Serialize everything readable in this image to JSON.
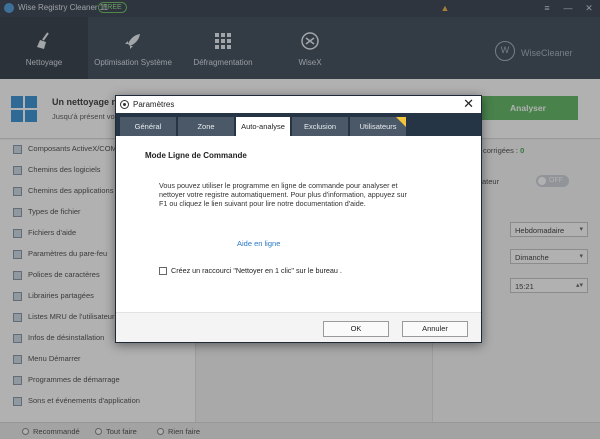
{
  "app": {
    "title": "Wise Registry Cleaner 11",
    "edition_badge": "FREE",
    "window_controls": [
      "≡",
      "—",
      "✕"
    ]
  },
  "toolbar": {
    "items": [
      {
        "label": "Nettoyage",
        "icon": "broom-icon"
      },
      {
        "label": "Optimisation Système",
        "icon": "rocket-icon"
      },
      {
        "label": "Défragmentation",
        "icon": "grid-icon"
      },
      {
        "label": "WiseX",
        "icon": "wisex-icon"
      }
    ],
    "brand": "WiseCleaner",
    "brand_logo": "W"
  },
  "header": {
    "title": "Un nettoyage n",
    "subtitle": "Jusqu'à présent vou",
    "analyze_button": "Analyser"
  },
  "sidebar": {
    "items": [
      {
        "label": "Composants ActiveX/COM"
      },
      {
        "label": "Chemins des logiciels"
      },
      {
        "label": "Chemins des applications"
      },
      {
        "label": "Types de fichier"
      },
      {
        "label": "Fichiers d'aide"
      },
      {
        "label": "Paramètres du pare-feu"
      },
      {
        "label": "Polices de caractères"
      },
      {
        "label": "Librairies partagées"
      },
      {
        "label": "Listes MRU de l'utilisateur"
      },
      {
        "label": "Infos de désinstallation"
      },
      {
        "label": "Menu Démarrer"
      },
      {
        "label": "Programmes de démarrage"
      },
      {
        "label": "Sons et événements d'application"
      }
    ]
  },
  "right_panel": {
    "corrected_label": "corrigées :",
    "corrected_value": "0",
    "schedule_label": "ateur",
    "toggle_state": "OFF",
    "frequency": "Hebdomadaire",
    "day": "Dimanche",
    "time": "15:21",
    "arrow_down": "▾",
    "spin_arrows": "▴▾"
  },
  "footer": {
    "options": [
      "Recommandé",
      "Tout faire",
      "Rien faire"
    ]
  },
  "dialog": {
    "title": "Paramètres",
    "close": "✕",
    "tabs": [
      "Général",
      "Zone",
      "Auto-analyse",
      "Exclusion",
      "Utilisateurs"
    ],
    "active_tab": "Auto-analyse",
    "heading": "Mode Ligne de Commande",
    "description": "Vous pouvez utiliser le programme en ligne de commande pour analyser et nettoyer votre registre automatiquement. Pour plus d'information, appuyez sur F1 ou cliquez le lien suivant pour lire notre documentation d'aide.",
    "help_link": "Aide en ligne",
    "checkbox_label": "Créez un raccourci \"Nettoyer en 1 clic\" sur le bureau .",
    "checkbox_checked": false,
    "ok_button": "OK",
    "cancel_button": "Annuler"
  },
  "colors": {
    "toolbar_bg": "#263545",
    "accent_green": "#4caf50",
    "link_blue": "#2b78c6",
    "tab_badge": "#f3c53a"
  }
}
